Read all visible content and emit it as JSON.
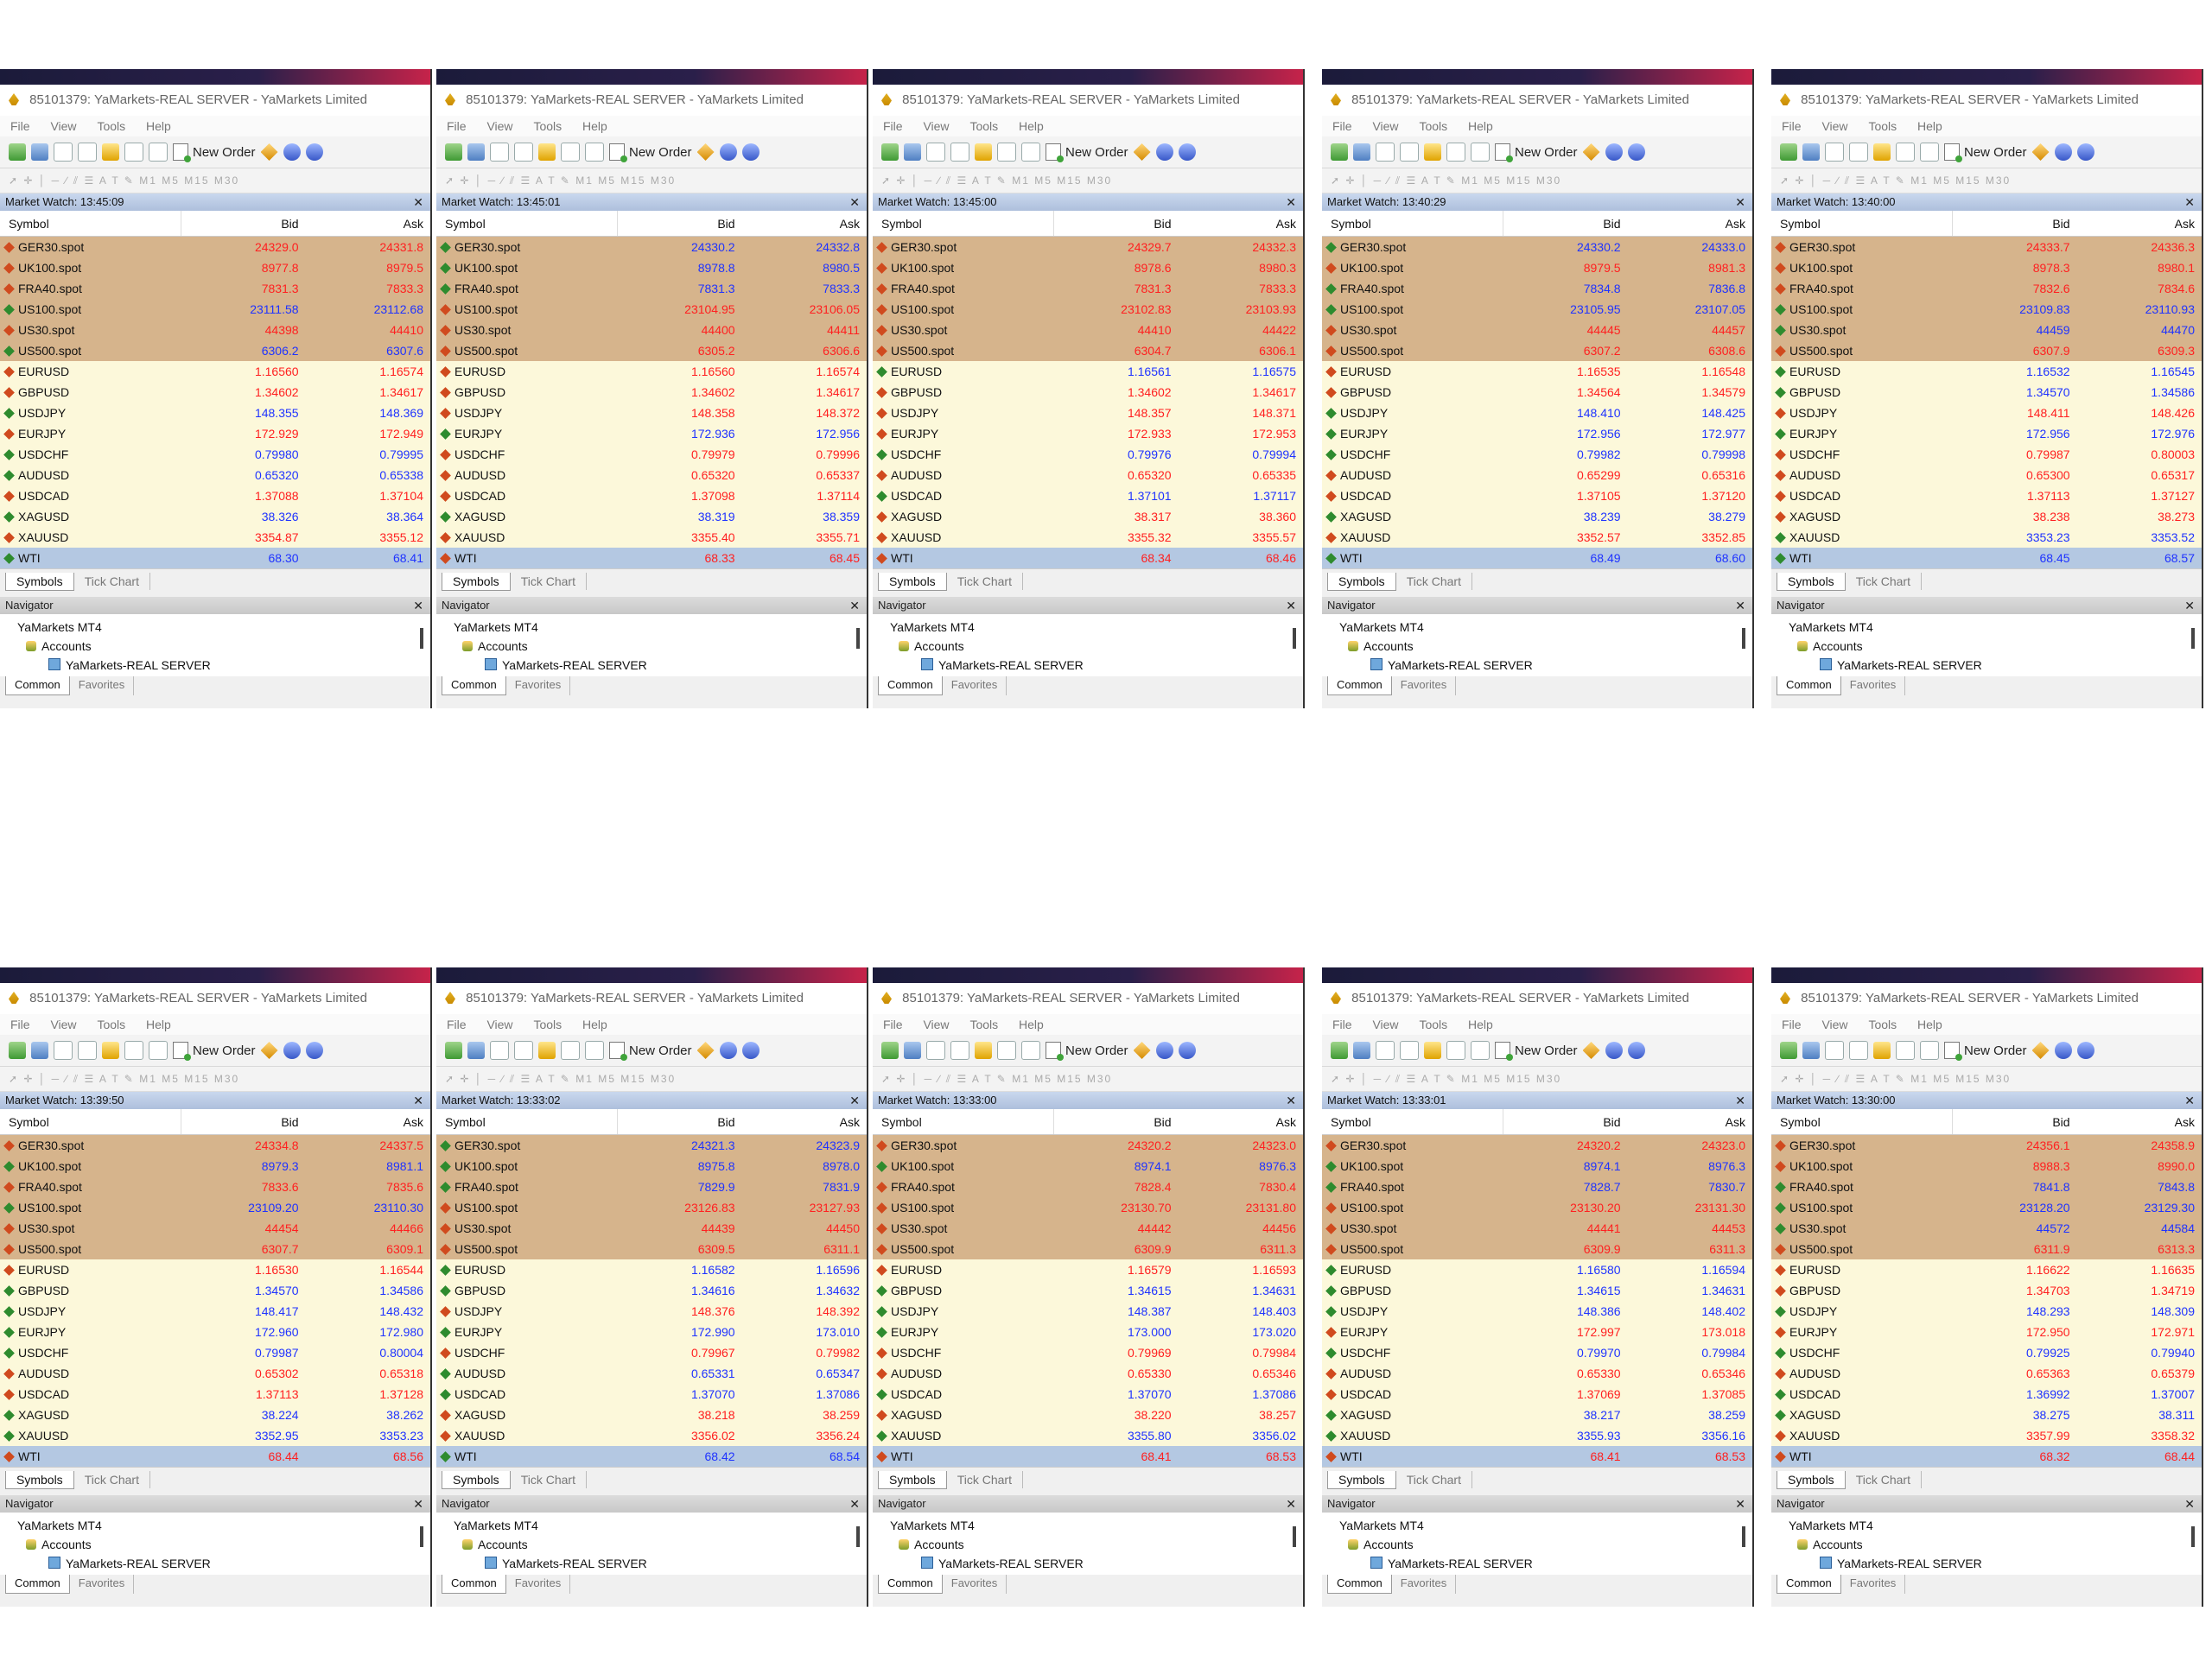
{
  "window": {
    "title": "85101379: YaMarkets-REAL SERVER - YaMarkets Limited",
    "menu": [
      "File",
      "View",
      "Tools",
      "Help"
    ],
    "new_order": "New Order",
    "timeframes": "M1 M5 M15 M30"
  },
  "columns": {
    "symbol": "Symbol",
    "bid": "Bid",
    "ask": "Ask"
  },
  "tabs": {
    "symbols": "Symbols",
    "tick_chart": "Tick Chart"
  },
  "navigator": {
    "title": "Navigator",
    "root": "YaMarkets MT4",
    "accounts": "Accounts",
    "server": "YaMarkets-REAL SERVER",
    "tab_common": "Common",
    "tab_favorites": "Favorites"
  },
  "symbols": [
    "GER30.spot",
    "UK100.spot",
    "FRA40.spot",
    "US100.spot",
    "US30.spot",
    "US500.spot",
    "EURUSD",
    "GBPUSD",
    "USDJPY",
    "EURJPY",
    "USDCHF",
    "AUDUSD",
    "USDCAD",
    "XAGUSD",
    "XAUUSD",
    "WTI"
  ],
  "panels": [
    {
      "time": "Market Watch: 13:45:09",
      "rows": [
        [
          "24329.0",
          "24331.8",
          "dn"
        ],
        [
          "8977.8",
          "8979.5",
          "dn"
        ],
        [
          "7831.3",
          "7833.3",
          "dn"
        ],
        [
          "23111.58",
          "23112.68",
          "up"
        ],
        [
          "44398",
          "44410",
          "dn"
        ],
        [
          "6306.2",
          "6307.6",
          "up"
        ],
        [
          "1.16560",
          "1.16574",
          "dn"
        ],
        [
          "1.34602",
          "1.34617",
          "dn"
        ],
        [
          "148.355",
          "148.369",
          "up"
        ],
        [
          "172.929",
          "172.949",
          "dn"
        ],
        [
          "0.79980",
          "0.79995",
          "up"
        ],
        [
          "0.65320",
          "0.65338",
          "up"
        ],
        [
          "1.37088",
          "1.37104",
          "dn"
        ],
        [
          "38.326",
          "38.364",
          "up"
        ],
        [
          "3354.87",
          "3355.12",
          "dn"
        ],
        [
          "68.30",
          "68.41",
          "up"
        ]
      ]
    },
    {
      "time": "Market Watch: 13:45:01",
      "rows": [
        [
          "24330.2",
          "24332.8",
          "up"
        ],
        [
          "8978.8",
          "8980.5",
          "up"
        ],
        [
          "7831.3",
          "7833.3",
          "up"
        ],
        [
          "23104.95",
          "23106.05",
          "dn"
        ],
        [
          "44400",
          "44411",
          "dn"
        ],
        [
          "6305.2",
          "6306.6",
          "dn"
        ],
        [
          "1.16560",
          "1.16574",
          "dn"
        ],
        [
          "1.34602",
          "1.34617",
          "dn"
        ],
        [
          "148.358",
          "148.372",
          "dn"
        ],
        [
          "172.936",
          "172.956",
          "up"
        ],
        [
          "0.79979",
          "0.79996",
          "dn"
        ],
        [
          "0.65320",
          "0.65337",
          "dn"
        ],
        [
          "1.37098",
          "1.37114",
          "dn"
        ],
        [
          "38.319",
          "38.359",
          "up"
        ],
        [
          "3355.40",
          "3355.71",
          "dn"
        ],
        [
          "68.33",
          "68.45",
          "dn"
        ]
      ]
    },
    {
      "time": "Market Watch: 13:45:00",
      "rows": [
        [
          "24329.7",
          "24332.3",
          "dn"
        ],
        [
          "8978.6",
          "8980.3",
          "dn"
        ],
        [
          "7831.3",
          "7833.3",
          "dn"
        ],
        [
          "23102.83",
          "23103.93",
          "dn"
        ],
        [
          "44410",
          "44422",
          "dn"
        ],
        [
          "6304.7",
          "6306.1",
          "dn"
        ],
        [
          "1.16561",
          "1.16575",
          "up"
        ],
        [
          "1.34602",
          "1.34617",
          "dn"
        ],
        [
          "148.357",
          "148.371",
          "dn"
        ],
        [
          "172.933",
          "172.953",
          "dn"
        ],
        [
          "0.79976",
          "0.79994",
          "up"
        ],
        [
          "0.65320",
          "0.65335",
          "dn"
        ],
        [
          "1.37101",
          "1.37117",
          "up"
        ],
        [
          "38.317",
          "38.360",
          "dn"
        ],
        [
          "3355.32",
          "3355.57",
          "dn"
        ],
        [
          "68.34",
          "68.46",
          "dn"
        ]
      ]
    },
    {
      "time": "Market Watch: 13:40:29",
      "rows": [
        [
          "24330.2",
          "24333.0",
          "up"
        ],
        [
          "8979.5",
          "8981.3",
          "dn"
        ],
        [
          "7834.8",
          "7836.8",
          "up"
        ],
        [
          "23105.95",
          "23107.05",
          "up"
        ],
        [
          "44445",
          "44457",
          "dn"
        ],
        [
          "6307.2",
          "6308.6",
          "dn"
        ],
        [
          "1.16535",
          "1.16548",
          "dn"
        ],
        [
          "1.34564",
          "1.34579",
          "dn"
        ],
        [
          "148.410",
          "148.425",
          "up"
        ],
        [
          "172.956",
          "172.977",
          "up"
        ],
        [
          "0.79982",
          "0.79998",
          "up"
        ],
        [
          "0.65299",
          "0.65316",
          "dn"
        ],
        [
          "1.37105",
          "1.37120",
          "dn"
        ],
        [
          "38.239",
          "38.279",
          "up"
        ],
        [
          "3352.57",
          "3352.85",
          "dn"
        ],
        [
          "68.49",
          "68.60",
          "up"
        ]
      ]
    },
    {
      "time": "Market Watch: 13:40:00",
      "rows": [
        [
          "24333.7",
          "24336.3",
          "dn"
        ],
        [
          "8978.3",
          "8980.1",
          "dn"
        ],
        [
          "7832.6",
          "7834.6",
          "dn"
        ],
        [
          "23109.83",
          "23110.93",
          "up"
        ],
        [
          "44459",
          "44470",
          "up"
        ],
        [
          "6307.9",
          "6309.3",
          "dn"
        ],
        [
          "1.16532",
          "1.16545",
          "up"
        ],
        [
          "1.34570",
          "1.34586",
          "up"
        ],
        [
          "148.411",
          "148.426",
          "dn"
        ],
        [
          "172.956",
          "172.976",
          "up"
        ],
        [
          "0.79987",
          "0.80003",
          "dn"
        ],
        [
          "0.65300",
          "0.65317",
          "dn"
        ],
        [
          "1.37113",
          "1.37127",
          "dn"
        ],
        [
          "38.238",
          "38.273",
          "dn"
        ],
        [
          "3353.23",
          "3353.52",
          "up"
        ],
        [
          "68.45",
          "68.57",
          "up"
        ]
      ]
    },
    {
      "time": "Market Watch: 13:39:50",
      "rows": [
        [
          "24334.8",
          "24337.5",
          "dn"
        ],
        [
          "8979.3",
          "8981.1",
          "up"
        ],
        [
          "7833.6",
          "7835.6",
          "dn"
        ],
        [
          "23109.20",
          "23110.30",
          "up"
        ],
        [
          "44454",
          "44466",
          "dn"
        ],
        [
          "6307.7",
          "6309.1",
          "dn"
        ],
        [
          "1.16530",
          "1.16544",
          "dn"
        ],
        [
          "1.34570",
          "1.34586",
          "up"
        ],
        [
          "148.417",
          "148.432",
          "up"
        ],
        [
          "172.960",
          "172.980",
          "up"
        ],
        [
          "0.79987",
          "0.80004",
          "up"
        ],
        [
          "0.65302",
          "0.65318",
          "dn"
        ],
        [
          "1.37113",
          "1.37128",
          "dn"
        ],
        [
          "38.224",
          "38.262",
          "up"
        ],
        [
          "3352.95",
          "3353.23",
          "up"
        ],
        [
          "68.44",
          "68.56",
          "dn"
        ]
      ]
    },
    {
      "time": "Market Watch: 13:33:02",
      "rows": [
        [
          "24321.3",
          "24323.9",
          "up"
        ],
        [
          "8975.8",
          "8978.0",
          "up"
        ],
        [
          "7829.9",
          "7831.9",
          "up"
        ],
        [
          "23126.83",
          "23127.93",
          "dn"
        ],
        [
          "44439",
          "44450",
          "dn"
        ],
        [
          "6309.5",
          "6311.1",
          "dn"
        ],
        [
          "1.16582",
          "1.16596",
          "up"
        ],
        [
          "1.34616",
          "1.34632",
          "up"
        ],
        [
          "148.376",
          "148.392",
          "dn"
        ],
        [
          "172.990",
          "173.010",
          "up"
        ],
        [
          "0.79967",
          "0.79982",
          "dn"
        ],
        [
          "0.65331",
          "0.65347",
          "up"
        ],
        [
          "1.37070",
          "1.37086",
          "up"
        ],
        [
          "38.218",
          "38.259",
          "dn"
        ],
        [
          "3356.02",
          "3356.24",
          "dn"
        ],
        [
          "68.42",
          "68.54",
          "up"
        ]
      ]
    },
    {
      "time": "Market Watch: 13:33:00",
      "rows": [
        [
          "24320.2",
          "24323.0",
          "dn"
        ],
        [
          "8974.1",
          "8976.3",
          "up"
        ],
        [
          "7828.4",
          "7830.4",
          "dn"
        ],
        [
          "23130.70",
          "23131.80",
          "dn"
        ],
        [
          "44442",
          "44456",
          "dn"
        ],
        [
          "6309.9",
          "6311.3",
          "dn"
        ],
        [
          "1.16579",
          "1.16593",
          "dn"
        ],
        [
          "1.34615",
          "1.34631",
          "up"
        ],
        [
          "148.387",
          "148.403",
          "up"
        ],
        [
          "173.000",
          "173.020",
          "up"
        ],
        [
          "0.79969",
          "0.79984",
          "dn"
        ],
        [
          "0.65330",
          "0.65346",
          "dn"
        ],
        [
          "1.37070",
          "1.37086",
          "up"
        ],
        [
          "38.220",
          "38.257",
          "dn"
        ],
        [
          "3355.80",
          "3356.02",
          "up"
        ],
        [
          "68.41",
          "68.53",
          "dn"
        ]
      ]
    },
    {
      "time": "Market Watch: 13:33:01",
      "rows": [
        [
          "24320.2",
          "24323.0",
          "dn"
        ],
        [
          "8974.1",
          "8976.3",
          "up"
        ],
        [
          "7828.7",
          "7830.7",
          "up"
        ],
        [
          "23130.20",
          "23131.30",
          "dn"
        ],
        [
          "44441",
          "44453",
          "dn"
        ],
        [
          "6309.9",
          "6311.3",
          "dn"
        ],
        [
          "1.16580",
          "1.16594",
          "up"
        ],
        [
          "1.34615",
          "1.34631",
          "up"
        ],
        [
          "148.386",
          "148.402",
          "up"
        ],
        [
          "172.997",
          "173.018",
          "dn"
        ],
        [
          "0.79970",
          "0.79984",
          "up"
        ],
        [
          "0.65330",
          "0.65346",
          "dn"
        ],
        [
          "1.37069",
          "1.37085",
          "dn"
        ],
        [
          "38.217",
          "38.259",
          "up"
        ],
        [
          "3355.93",
          "3356.16",
          "up"
        ],
        [
          "68.41",
          "68.53",
          "dn"
        ]
      ]
    },
    {
      "time": "Market Watch: 13:30:00",
      "rows": [
        [
          "24356.1",
          "24358.9",
          "dn"
        ],
        [
          "8988.3",
          "8990.0",
          "dn"
        ],
        [
          "7841.8",
          "7843.8",
          "up"
        ],
        [
          "23128.20",
          "23129.30",
          "up"
        ],
        [
          "44572",
          "44584",
          "up"
        ],
        [
          "6311.9",
          "6313.3",
          "dn"
        ],
        [
          "1.16622",
          "1.16635",
          "dn"
        ],
        [
          "1.34703",
          "1.34719",
          "dn"
        ],
        [
          "148.293",
          "148.309",
          "up"
        ],
        [
          "172.950",
          "172.971",
          "dn"
        ],
        [
          "0.79925",
          "0.79940",
          "up"
        ],
        [
          "0.65363",
          "0.65379",
          "dn"
        ],
        [
          "1.36992",
          "1.37007",
          "up"
        ],
        [
          "38.275",
          "38.311",
          "up"
        ],
        [
          "3357.99",
          "3358.32",
          "dn"
        ],
        [
          "68.32",
          "68.44",
          "dn"
        ]
      ]
    }
  ]
}
